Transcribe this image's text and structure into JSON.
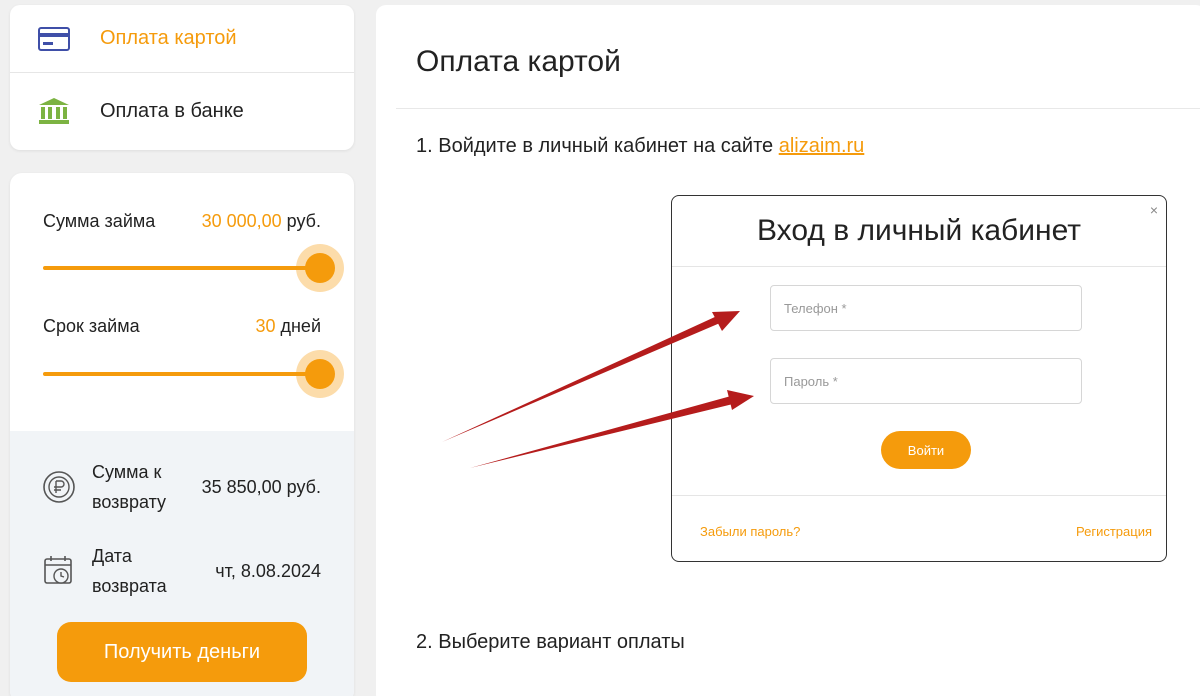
{
  "nav": {
    "items": [
      {
        "label": "Оплата картой",
        "icon": "credit-card-icon",
        "active": true
      },
      {
        "label": "Оплата в банке",
        "icon": "bank-icon",
        "active": false
      }
    ]
  },
  "calculator": {
    "amount": {
      "label": "Сумма займа",
      "value": "30 000,00",
      "unit": "руб.",
      "slider_fraction": 1.0
    },
    "term": {
      "label": "Срок займа",
      "value": "30",
      "unit": "дней",
      "slider_fraction": 1.0
    },
    "return_sum": {
      "label_line1": "Сумма к",
      "label_line2": "возврату",
      "value": "35 850,00 руб.",
      "icon": "ruble-coin-icon"
    },
    "return_date": {
      "label_line1": "Дата",
      "label_line2": "возврата",
      "value": "чт, 8.08.2024",
      "icon": "calendar-clock-icon"
    },
    "button_label": "Получить деньги"
  },
  "content": {
    "title": "Оплата картой",
    "step1_text": "1. Войдите в личный кабинет на сайте ",
    "step1_link": "alizaim.ru",
    "step2_text": "2. Выберите вариант оплаты",
    "modal": {
      "title": "Вход в личный кабинет",
      "close": "×",
      "phone_placeholder": "Телефон *",
      "password_placeholder": "Пароль *",
      "login_label": "Войти",
      "forgot_label": "Забыли пароль?",
      "register_label": "Регистрация"
    }
  },
  "colors": {
    "accent": "#f59b0c",
    "arrow": "#b51c1c",
    "card_icon": "#3f4fa8",
    "bank_icon": "#7cb342"
  }
}
